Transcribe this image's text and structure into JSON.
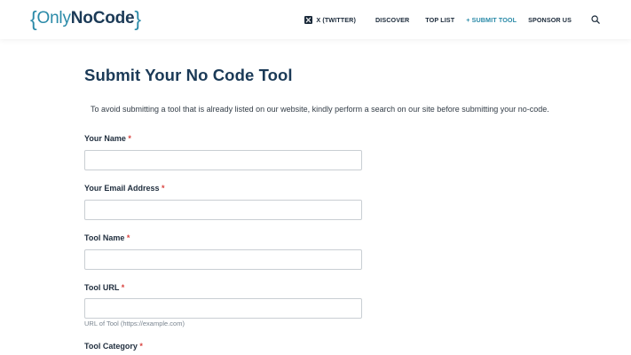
{
  "header": {
    "logo": {
      "brace_open": "{",
      "only": "Only",
      "nocode": "NoCode",
      "brace_close": "}"
    },
    "nav": [
      {
        "label": "X (TWITTER)",
        "icon": "x-logo-icon"
      },
      {
        "label": "DISCOVER"
      },
      {
        "label": "TOP LIST"
      },
      {
        "label": "+ SUBMIT TOOL",
        "active": true
      },
      {
        "label": "SPONSOR US"
      }
    ],
    "search_icon": "search-icon"
  },
  "page": {
    "title": "Submit Your No Code Tool",
    "intro": "To avoid submitting a tool that is already listed on our website, kindly perform a search on our site before submitting your no-code."
  },
  "form": {
    "required_marker": "*",
    "fields": [
      {
        "label": "Your Name",
        "value": ""
      },
      {
        "label": "Your Email Address",
        "value": ""
      },
      {
        "label": "Tool Name",
        "value": ""
      },
      {
        "label": "Tool URL",
        "value": "",
        "help": "URL of Tool (https://example.com)"
      },
      {
        "label": "Tool Category"
      }
    ]
  },
  "colors": {
    "brand_teal": "#2a8aa8",
    "brand_navy": "#1b3a57",
    "required_red": "#d9433f"
  }
}
